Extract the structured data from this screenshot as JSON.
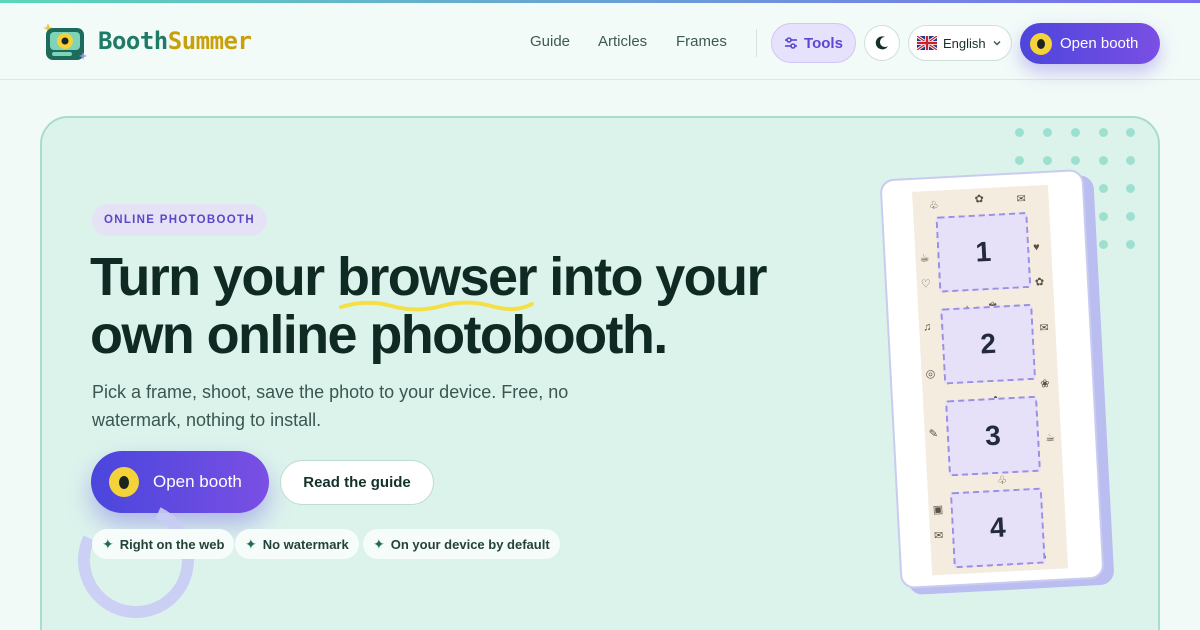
{
  "header": {
    "brand_part1": "Booth",
    "brand_part2": "Summer",
    "nav": [
      "Guide",
      "Articles",
      "Frames"
    ],
    "tools_label": "Tools",
    "language_label": "English",
    "open_booth_label": "Open booth"
  },
  "hero": {
    "eyebrow": "ONLINE PHOTOBOOTH",
    "headline_before": "Turn your ",
    "headline_highlight1": "browser",
    "headline_middle": " into your own online ",
    "headline_highlight2": "photobooth",
    "headline_after": ".",
    "subtitle": "Pick a frame, shoot, save the photo to your device. Free, no watermark, nothing to install.",
    "cta_label": "Open booth",
    "guide_label": "Read the guide",
    "features": [
      "Right on the web",
      "No watermark",
      "On your device by default"
    ],
    "frames": [
      "1",
      "2",
      "3",
      "4"
    ]
  },
  "colors": {
    "accent": "#5a47d6",
    "brand_teal": "#1e7b68",
    "brand_gold": "#c8a10a",
    "hero_bg": "#dcf3ec"
  },
  "icons": [
    "logo-icon",
    "sliders-icon",
    "moon-icon",
    "uk-flag-icon",
    "chevron-down-icon",
    "sparkle-icon"
  ]
}
